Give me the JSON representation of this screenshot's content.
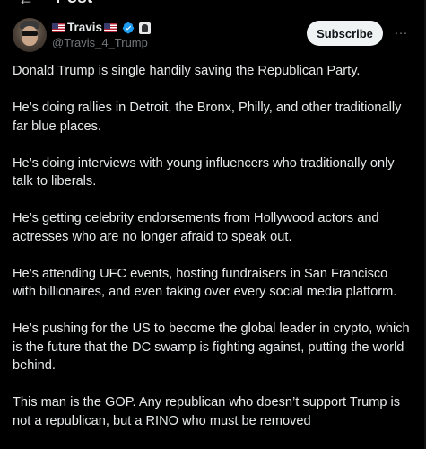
{
  "header": {
    "back_icon": "arrow-left-icon",
    "title": "Post"
  },
  "author": {
    "name": "Travis",
    "handle": "@Travis_4_Trump",
    "verified_color": "#1d9bf0",
    "icons": [
      "us-flag-icon",
      "us-flag-icon",
      "verified-badge-icon",
      "affiliate-badge-icon"
    ]
  },
  "actions": {
    "subscribe_label": "Subscribe",
    "more_label": "···"
  },
  "tweet": {
    "paragraphs": [
      "Donald Trump is single handily saving the Republican Party.",
      "He’s doing rallies in Detroit, the Bronx, Philly, and other traditionally far blue places.",
      "He’s doing interviews with young influencers who traditionally only talk to liberals.",
      "He’s getting celebrity endorsements from Hollywood actors and actresses who are no longer afraid to speak out.",
      "He’s attending UFC events, hosting fundraisers in San Francisco with billionaires, and even taking over every social media platform.",
      "He’s pushing for the US to become the global leader in crypto, which is the future that the DC swamp is fighting against, putting the world behind.",
      "This man is the GOP.  Any republican who doesn’t support Trump is not a republican, but a RINO who must be removed"
    ]
  },
  "colors": {
    "background": "#000000",
    "text": "#e7e9ea",
    "secondary": "#71767b",
    "button_bg": "#eff3f4"
  }
}
